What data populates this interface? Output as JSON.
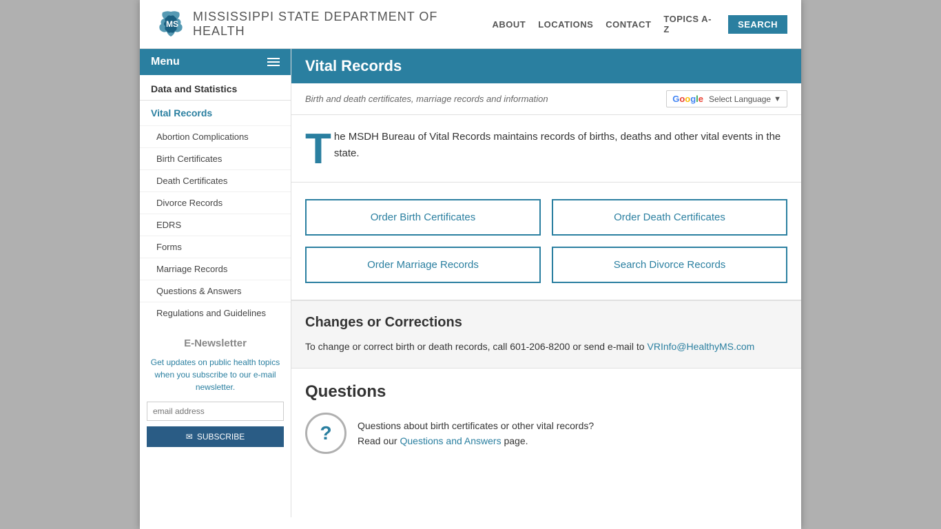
{
  "header": {
    "title": "Mississippi State Department of Health",
    "nav": {
      "about": "ABOUT",
      "locations": "LOCATIONS",
      "contact": "CONTACT",
      "topics": "TOPICS A-Z",
      "search": "SEARCH"
    }
  },
  "sidebar": {
    "menu_label": "Menu",
    "section_title": "Data and Statistics",
    "parent_item": "Vital Records",
    "children": [
      "Abortion Complications",
      "Birth Certificates",
      "Death Certificates",
      "Divorce Records",
      "EDRS",
      "Forms",
      "Marriage Records",
      "Questions & Answers",
      "Regulations and Guidelines"
    ],
    "enewsletter": {
      "title": "E-Newsletter",
      "description": "Get updates on public health topics when you subscribe to our e-mail newsletter.",
      "input_placeholder": "email address",
      "button_label": "SUBSCRIBE"
    }
  },
  "content": {
    "page_title": "Vital Records",
    "subtitle": "Birth and death certificates, marriage records and information",
    "translate_label": "Select Language",
    "intro_drop_cap": "T",
    "intro_text": "he MSDH Bureau of Vital Records maintains records of births, deaths and other vital events in the state.",
    "buttons": {
      "order_birth": "Order Birth Certificates",
      "order_death": "Order Death Certificates",
      "order_marriage": "Order Marriage Records",
      "search_divorce": "Search Divorce Records"
    },
    "changes": {
      "title": "Changes or Corrections",
      "text": "To change or correct birth or death records, call 601-206-8200 or send e-mail to",
      "email": "VRInfo@HealthyMS.com"
    },
    "questions": {
      "title": "Questions",
      "text": "Questions about birth certificates or other vital records?\nRead our",
      "link_text": "Questions and Answers",
      "text_end": "page."
    }
  }
}
